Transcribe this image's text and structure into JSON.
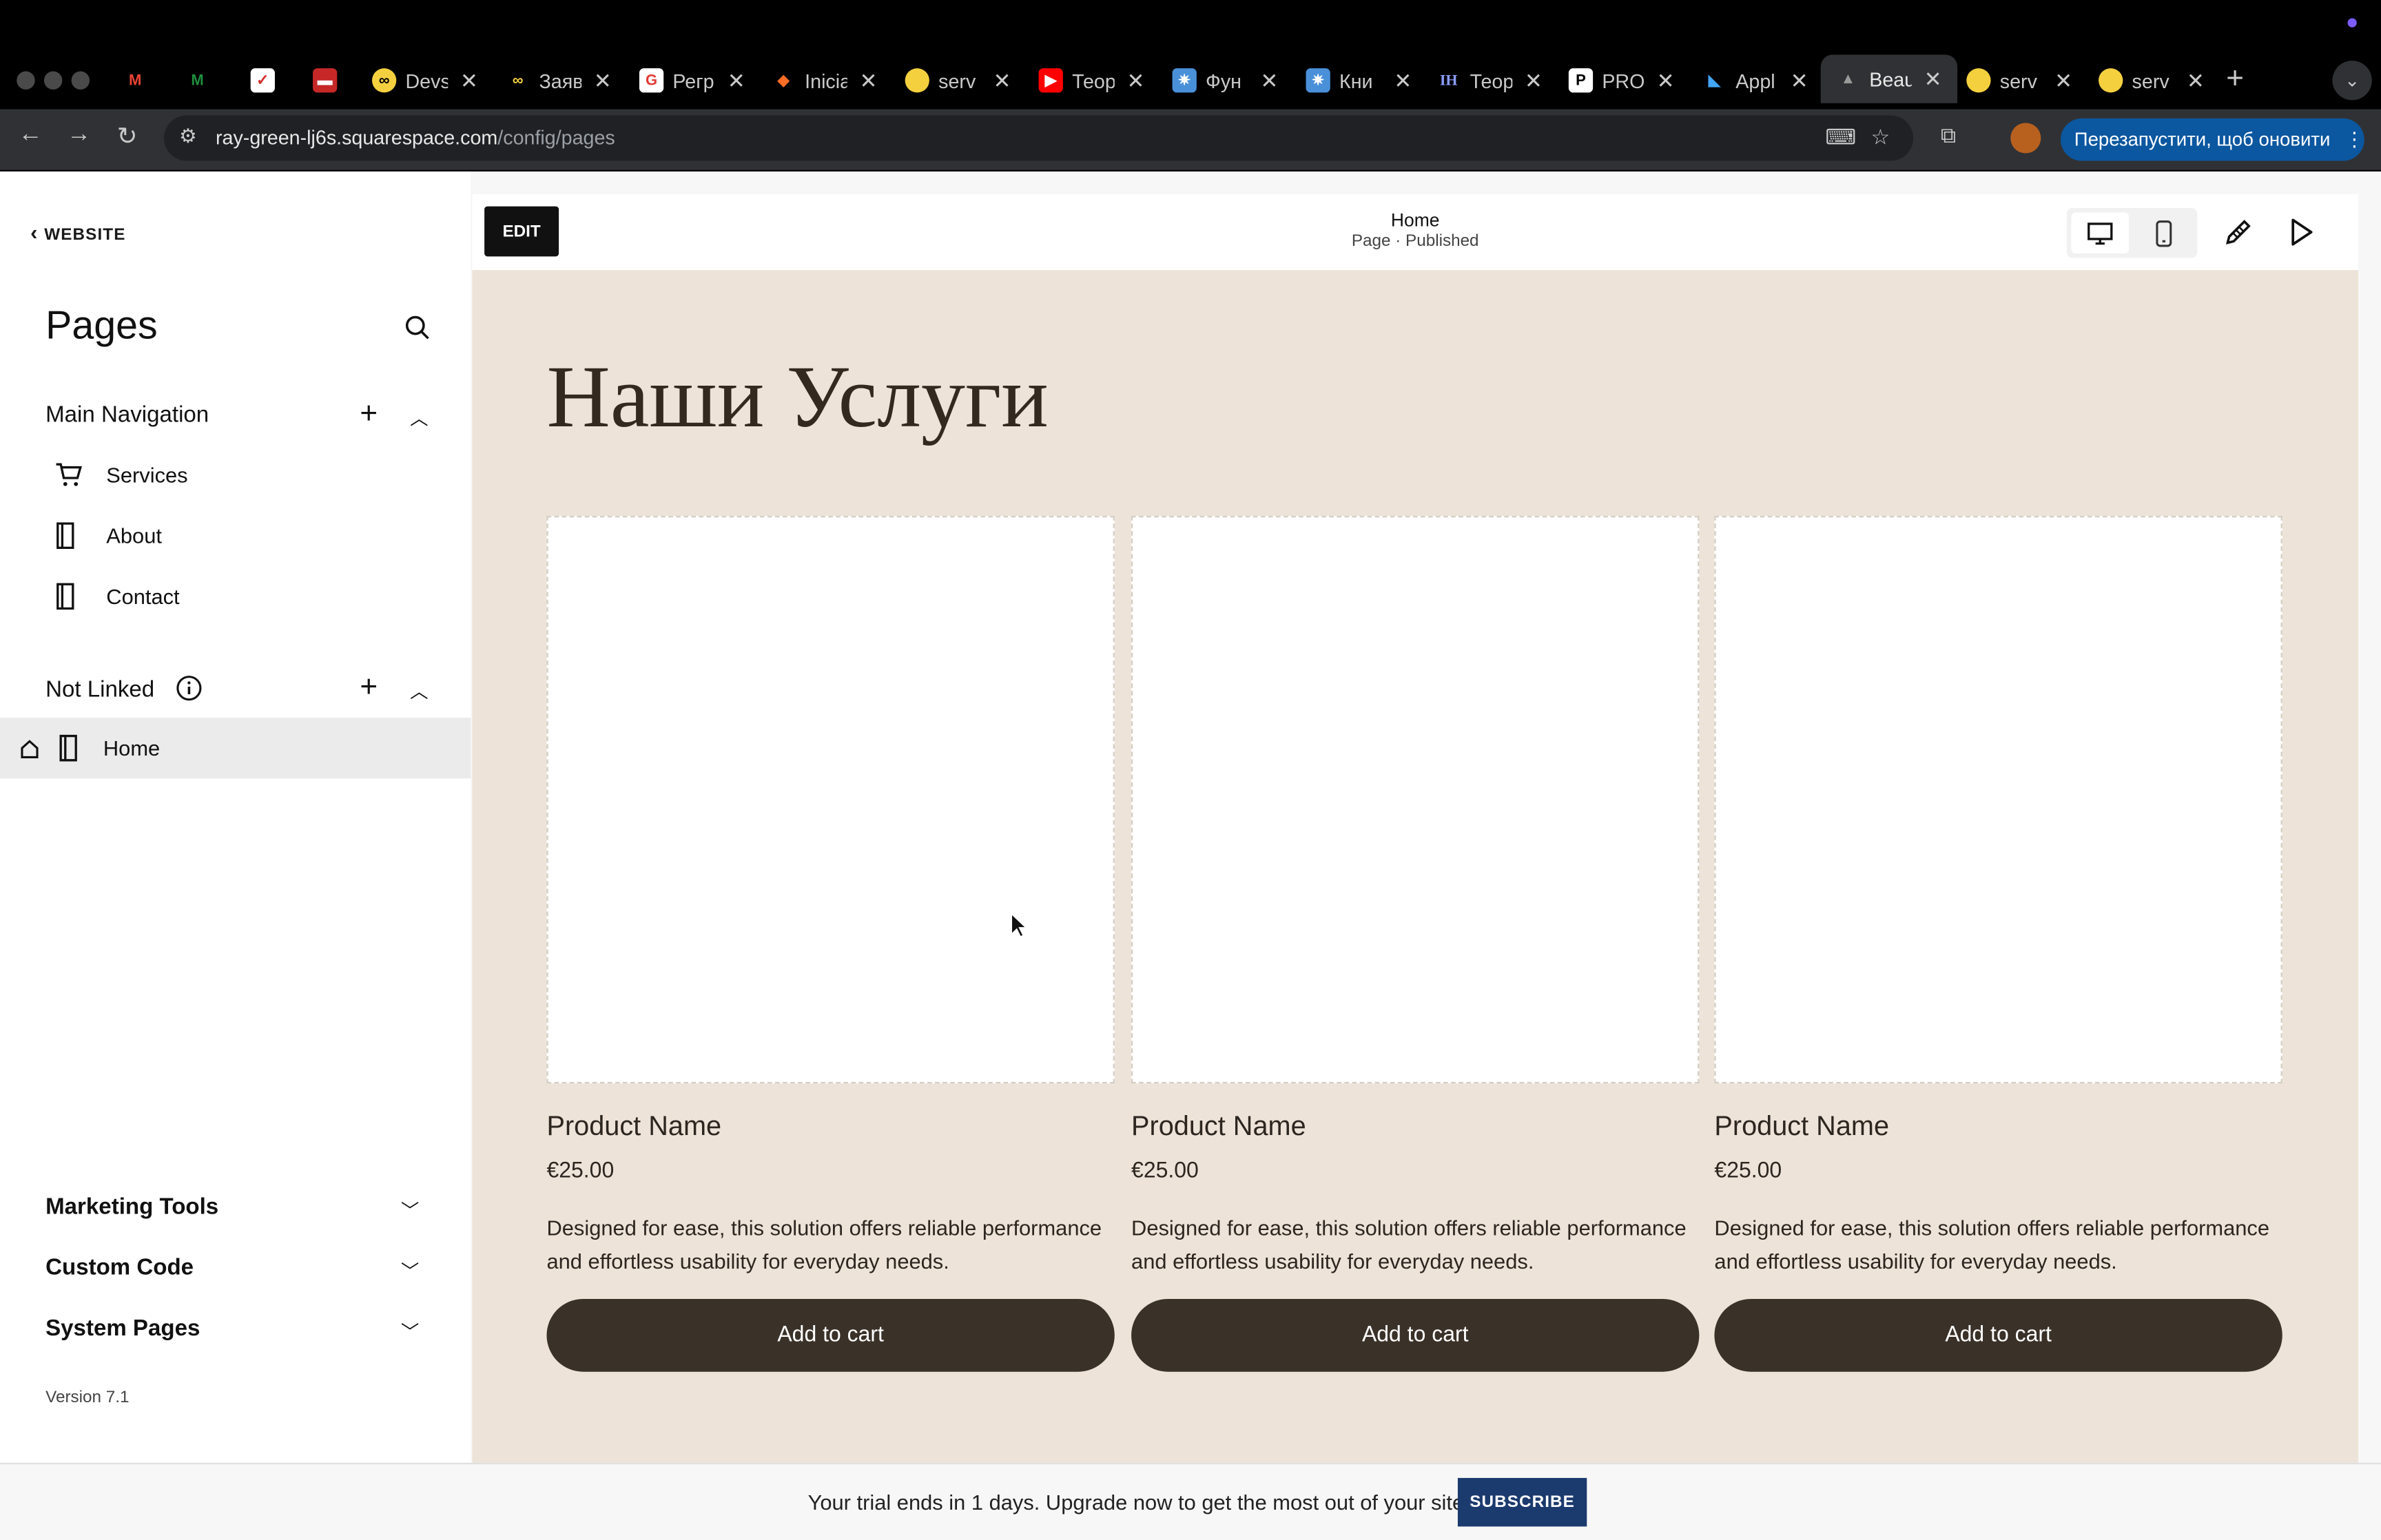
{
  "browser": {
    "tabs": [
      {
        "label": "",
        "icon": "gmail-icon",
        "color": "#ea4335"
      },
      {
        "label": "",
        "icon": "mail-icon",
        "color": "#1e8e3e"
      },
      {
        "label": "",
        "icon": "calendar-icon",
        "color": "#ffffff"
      },
      {
        "label": "",
        "icon": "app-icon",
        "color": "#c62828"
      },
      {
        "label": "Devs",
        "icon": "devs-icon",
        "color": "#f4d03f"
      },
      {
        "label": "Заяв",
        "icon": "link-icon",
        "color": "#f4d03f"
      },
      {
        "label": "Регр",
        "icon": "regr-icon",
        "color": "#e53935"
      },
      {
        "label": "Inicia",
        "icon": "gitlab-icon",
        "color": "#fc6d26"
      },
      {
        "label": "serv",
        "icon": "serv-icon",
        "color": "#f4d03f"
      },
      {
        "label": "Теор",
        "icon": "youtube-icon",
        "color": "#ff0000"
      },
      {
        "label": "Фун",
        "icon": "fun-icon",
        "color": "#4a90d9"
      },
      {
        "label": "Кни",
        "icon": "book-icon",
        "color": "#4a90d9"
      },
      {
        "label": "Теор",
        "icon": "ih-icon",
        "color": "#1a237e"
      },
      {
        "label": "PRO",
        "icon": "p-icon",
        "color": "#ffffff"
      },
      {
        "label": "Appl",
        "icon": "flutter-icon",
        "color": "#42a5f5"
      },
      {
        "label": "Beau",
        "icon": "squarespace-icon",
        "color": "#888888",
        "active": true
      },
      {
        "label": "serv",
        "icon": "serv-icon",
        "color": "#f4d03f"
      },
      {
        "label": "serv",
        "icon": "serv-icon",
        "color": "#f4d03f"
      }
    ],
    "new_tab": "+",
    "url_host": "ray-green-lj6s.squarespace.com",
    "url_path": "/config/pages",
    "restart_button": "Перезапустити, щоб оновити"
  },
  "sidebar": {
    "back_label": "WEBSITE",
    "title": "Pages",
    "main_nav": {
      "title": "Main Navigation",
      "items": [
        {
          "label": "Services",
          "icon": "cart-icon"
        },
        {
          "label": "About",
          "icon": "page-icon"
        },
        {
          "label": "Contact",
          "icon": "page-icon"
        }
      ]
    },
    "not_linked": {
      "title": "Not Linked",
      "items": [
        {
          "label": "Home",
          "icon": "page-icon"
        }
      ]
    },
    "bottom_sections": [
      "Marketing Tools",
      "Custom Code",
      "System Pages"
    ],
    "version": "Version 7.1"
  },
  "editor": {
    "edit_button": "EDIT",
    "page_name": "Home",
    "page_status": "Page · Published"
  },
  "canvas": {
    "heading": "Наши Услуги",
    "products": [
      {
        "name": "Product Name",
        "price": "€25.00",
        "description": "Designed for ease, this solution offers reliable performance and effortless usability for everyday needs.",
        "button": "Add to cart"
      },
      {
        "name": "Product Name",
        "price": "€25.00",
        "description": "Designed for ease, this solution offers reliable performance and effortless usability for everyday needs.",
        "button": "Add to cart"
      },
      {
        "name": "Product Name",
        "price": "€25.00",
        "description": "Designed for ease, this solution offers reliable performance and effortless usability for everyday needs.",
        "button": "Add to cart"
      }
    ]
  },
  "trial": {
    "text": "Your trial ends in 1 days. Upgrade now to get the most out of your site.",
    "subscribe": "SUBSCRIBE"
  },
  "colors": {
    "canvas_bg": "#ede3d8",
    "button_dark": "#3a3128",
    "subscribe_bg": "#1b3a6e",
    "restart_bg": "#0b57a0"
  }
}
